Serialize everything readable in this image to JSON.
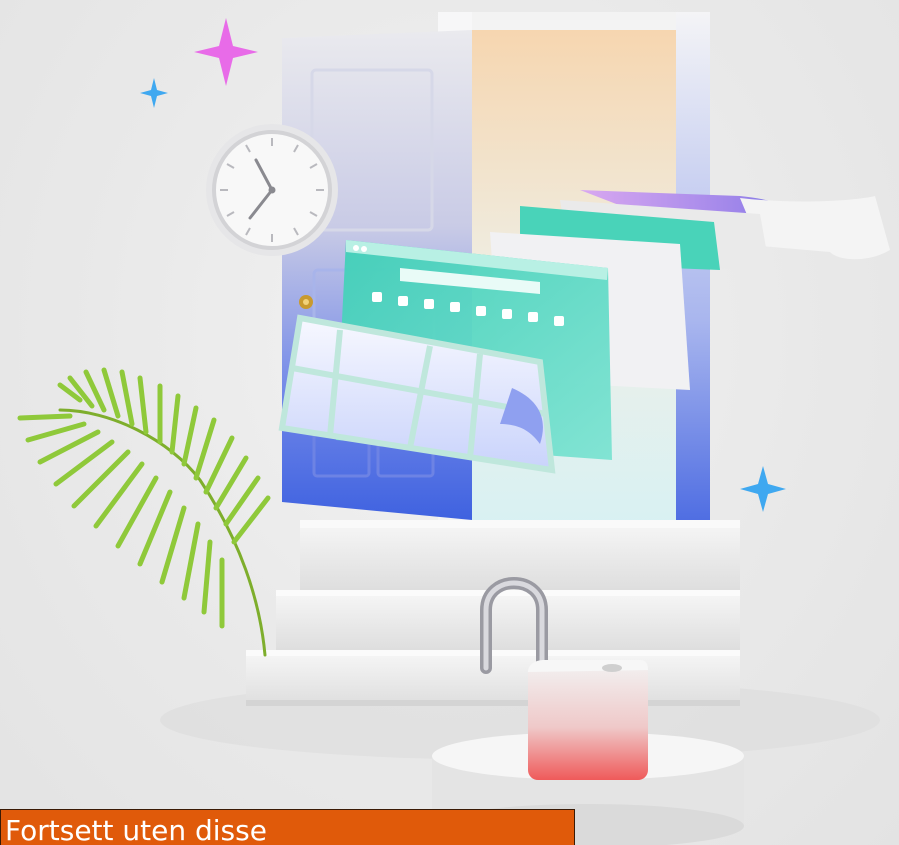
{
  "continue_button": {
    "label": "Fortsett uten disse"
  },
  "colors": {
    "accent_orange": "#e05a0a",
    "door_blue": "#3f62e0",
    "sparkle_pink": "#e86be8",
    "sparkle_blue": "#3fa8f0",
    "leaf_green": "#8fc93a"
  },
  "icons": [
    "sparkle-icon",
    "clock-icon",
    "open-door-icon",
    "browser-window-icon",
    "document-icon",
    "palm-leaf-icon",
    "padlock-icon"
  ]
}
